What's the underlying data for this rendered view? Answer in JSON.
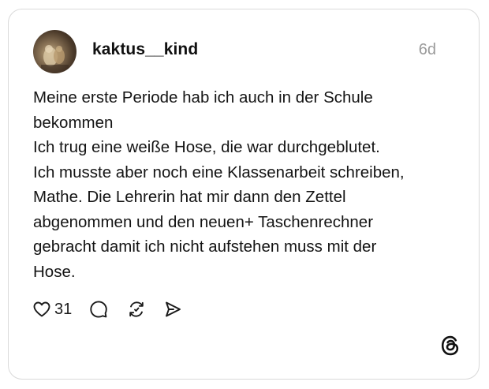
{
  "post": {
    "username": "kaktus__kind",
    "time": "6d",
    "lines": [
      "Meine erste Periode hab ich auch in der Schule",
      "bekommen",
      "Ich trug eine weiße Hose, die war durchgeblutet.",
      "Ich musste aber noch eine Klassenarbeit schreiben,",
      "Mathe. Die Lehrerin hat mir dann den Zettel",
      "abgenommen und den neuen+ Taschenrechner",
      "gebracht damit ich nicht aufstehen muss mit der",
      "Hose."
    ],
    "like_count": "31"
  },
  "icons": {
    "like": "heart-icon",
    "reply": "comment-icon",
    "repost": "repost-icon",
    "share": "send-icon",
    "brand": "threads-logo-icon"
  },
  "colors": {
    "text": "#141414",
    "muted": "#9a9a9a",
    "border": "#d9d9d9"
  }
}
